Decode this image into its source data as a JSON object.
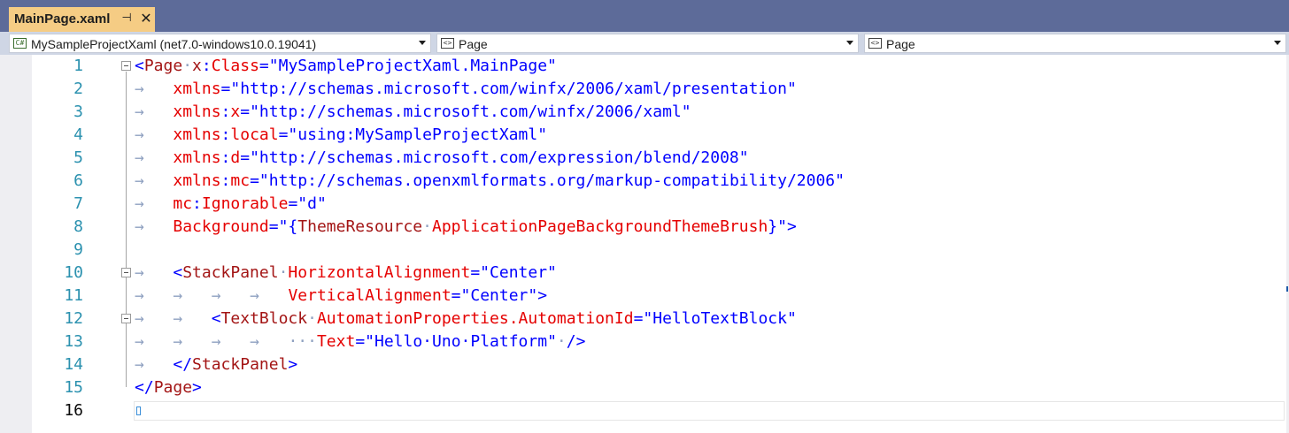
{
  "tab": {
    "title": "MainPage.xaml",
    "pin_icon": "pin-icon",
    "close_icon": "close-icon"
  },
  "navbar": {
    "project": {
      "icon": "csharp-project-icon",
      "label": "MySampleProjectXaml (net7.0-windows10.0.19041)"
    },
    "type": {
      "icon": "element-icon",
      "label": "Page"
    },
    "member": {
      "icon": "element-icon",
      "label": "Page"
    }
  },
  "editor": {
    "current_line": 16,
    "lines": [
      {
        "num": "1"
      },
      {
        "num": "2"
      },
      {
        "num": "3"
      },
      {
        "num": "4"
      },
      {
        "num": "5"
      },
      {
        "num": "6"
      },
      {
        "num": "7"
      },
      {
        "num": "8"
      },
      {
        "num": "9"
      },
      {
        "num": "10"
      },
      {
        "num": "11"
      },
      {
        "num": "12"
      },
      {
        "num": "13"
      },
      {
        "num": "14"
      },
      {
        "num": "15"
      },
      {
        "num": "16"
      }
    ],
    "tokens": {
      "l1": [
        "<",
        "Page",
        "·",
        "x",
        ":",
        "Class",
        "=\"",
        "MySampleProjectXaml.MainPage",
        "\""
      ],
      "l2": [
        "xmlns",
        "=\"",
        "http://schemas.microsoft.com/winfx/2006/xaml/presentation",
        "\""
      ],
      "l3": [
        "xmlns",
        ":",
        "x",
        "=\"",
        "http://schemas.microsoft.com/winfx/2006/xaml",
        "\""
      ],
      "l4": [
        "xmlns",
        ":",
        "local",
        "=\"",
        "using:MySampleProjectXaml",
        "\""
      ],
      "l5": [
        "xmlns",
        ":",
        "d",
        "=\"",
        "http://schemas.microsoft.com/expression/blend/2008",
        "\""
      ],
      "l6": [
        "xmlns",
        ":",
        "mc",
        "=\"",
        "http://schemas.openxmlformats.org/markup-compatibility/2006",
        "\""
      ],
      "l7": [
        "mc",
        ":",
        "Ignorable",
        "=\"",
        "d",
        "\""
      ],
      "l8": [
        "Background",
        "=\"",
        "{",
        "ThemeResource",
        "·",
        "ApplicationPageBackgroundThemeBrush",
        "}",
        "\">"
      ],
      "l10": [
        "<",
        "StackPanel",
        "·",
        "HorizontalAlignment",
        "=\"",
        "Center",
        "\""
      ],
      "l11": [
        "VerticalAlignment",
        "=\"",
        "Center",
        "\">"
      ],
      "l12": [
        "<",
        "TextBlock",
        "·",
        "AutomationProperties.AutomationId",
        "=\"",
        "HelloTextBlock",
        "\""
      ],
      "l13": [
        "···",
        "Text",
        "=\"",
        "Hello·Uno·Platform",
        "\"",
        "·",
        "/>"
      ],
      "l14": [
        "</",
        "StackPanel",
        ">"
      ],
      "l15": [
        "</",
        "Page",
        ">"
      ]
    },
    "tab_glyph": "→"
  }
}
